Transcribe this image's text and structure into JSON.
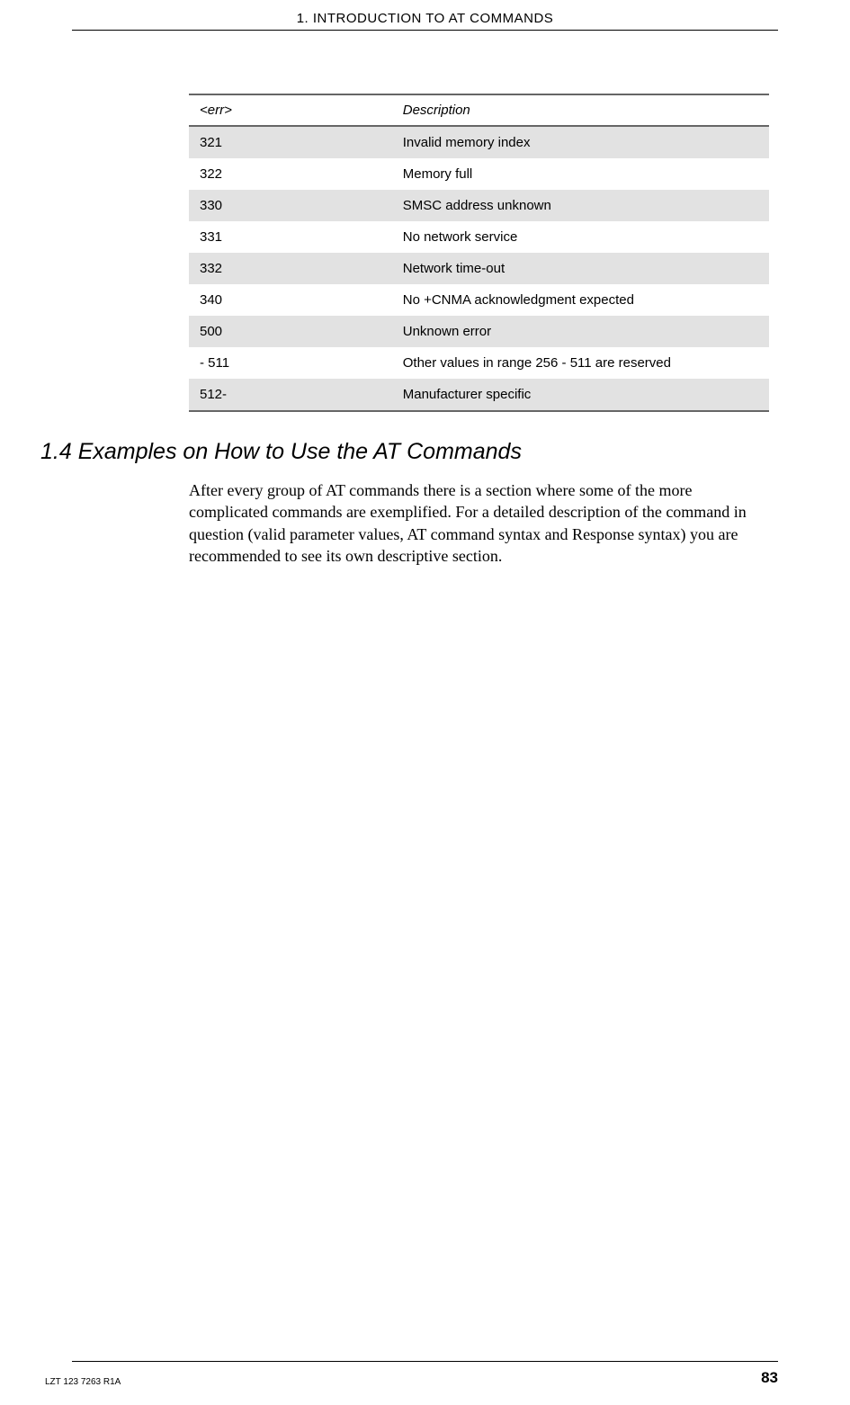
{
  "header": {
    "title": "1. INTRODUCTION TO AT COMMANDS"
  },
  "table": {
    "headers": {
      "err": "<err>",
      "description": "Description"
    },
    "rows": [
      {
        "err": "321",
        "description": "Invalid memory index"
      },
      {
        "err": "322",
        "description": "Memory full"
      },
      {
        "err": "330",
        "description": "SMSC address unknown"
      },
      {
        "err": "331",
        "description": "No network service"
      },
      {
        "err": "332",
        "description": "Network time-out"
      },
      {
        "err": "340",
        "description": "No +CNMA acknowledgment expected"
      },
      {
        "err": "500",
        "description": "Unknown error"
      },
      {
        "err": "- 511",
        "description": "Other values in range 256 - 511 are reserved"
      },
      {
        "err": "512-",
        "description": "Manufacturer specific"
      }
    ]
  },
  "section": {
    "heading": "1.4  Examples on How to Use the AT Commands",
    "body": "After every group of AT commands there is a section where some of the more complicated commands are exemplified. For a detailed description of the command in question (valid parameter values, AT command syntax and Response syntax) you are recommended to see its own descriptive section."
  },
  "footer": {
    "doc_id": "LZT 123 7263 R1A",
    "page_number": "83"
  }
}
